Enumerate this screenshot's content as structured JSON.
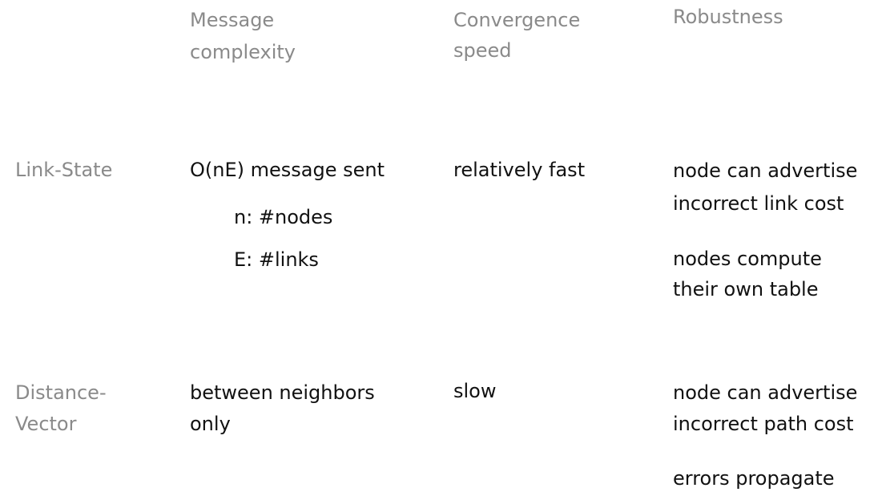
{
  "headers": {
    "message_complexity": [
      "Message",
      "complexity"
    ],
    "convergence_speed": [
      "Convergence",
      "speed"
    ],
    "robustness": "Robustness"
  },
  "rows": [
    {
      "label": "Link-State",
      "message_complexity": "O(nE) message sent",
      "notes": [
        "n: #nodes",
        "E:  #links"
      ],
      "convergence_speed": "relatively fast",
      "robustness": [
        [
          "node can advertise",
          "incorrect link cost"
        ],
        [
          "nodes compute",
          "their own table"
        ]
      ]
    },
    {
      "label": [
        "Distance-",
        "Vector"
      ],
      "message_complexity": [
        "between neighbors",
        "only"
      ],
      "convergence_speed": "slow",
      "robustness": [
        [
          "node can advertise",
          "incorrect path cost"
        ],
        [
          "errors propagate"
        ]
      ]
    }
  ]
}
